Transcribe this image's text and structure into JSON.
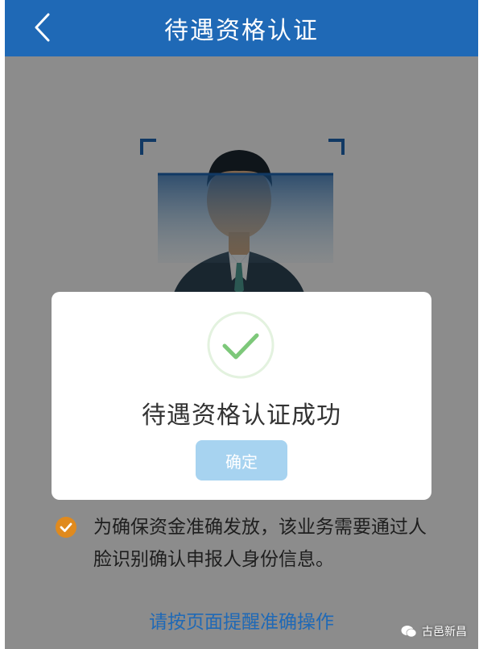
{
  "header": {
    "title": "待遇资格认证",
    "back_icon": "chevron-left-icon"
  },
  "dialog": {
    "message": "待遇资格认证成功",
    "confirm_label": "确定",
    "status_icon": "check-circle-icon"
  },
  "notice": {
    "icon": "check-badge-icon",
    "text": "为确保资金准确发放，该业务需要通过人脸识别确认申报人身份信息。"
  },
  "action_link": "请按页面提醒准确操作",
  "watermark": "古邑新昌",
  "colors": {
    "header_bg": "#1f69b6",
    "accent_green": "#7dc87a",
    "confirm_bg": "#a7d3f0",
    "badge_orange": "#e08a1e",
    "link_blue": "#1f69b6"
  }
}
